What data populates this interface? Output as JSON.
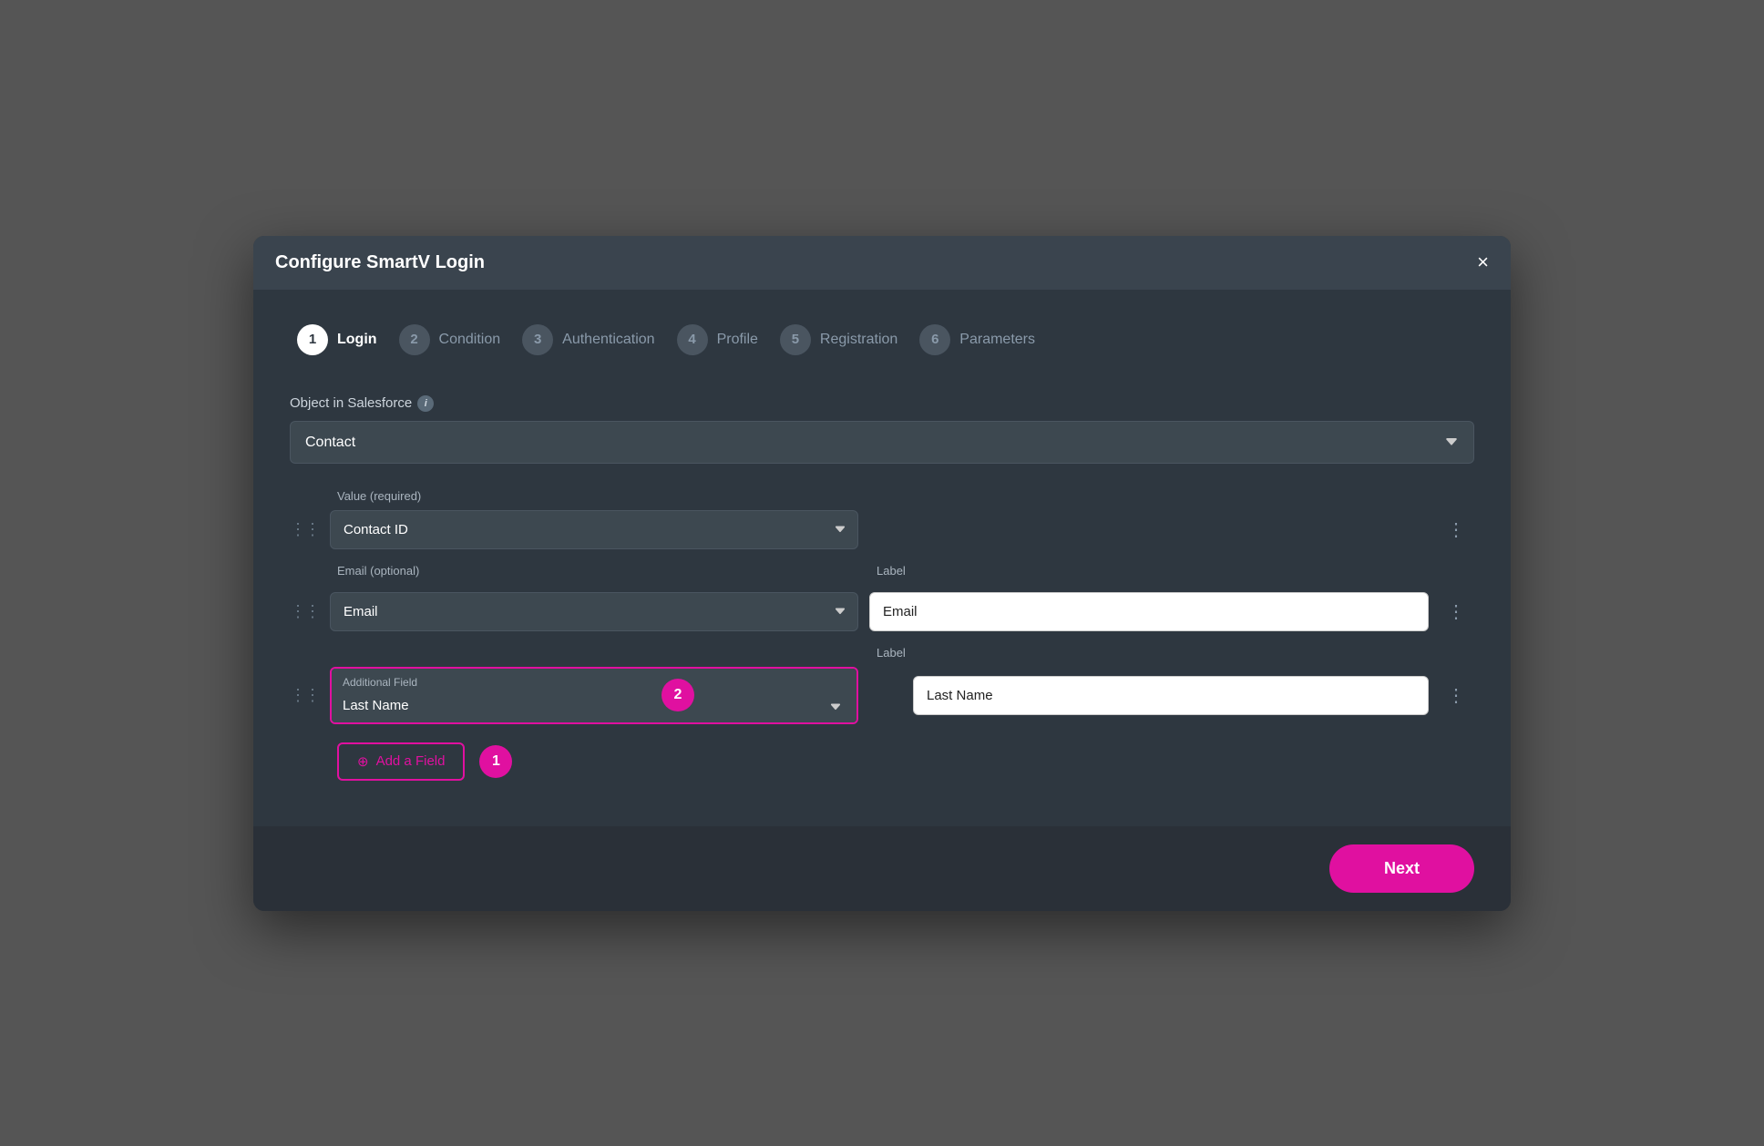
{
  "modal": {
    "title": "Configure SmartV Login",
    "close_label": "×"
  },
  "steps": [
    {
      "number": "1",
      "label": "Login",
      "active": true
    },
    {
      "number": "2",
      "label": "Condition",
      "active": false
    },
    {
      "number": "3",
      "label": "Authentication",
      "active": false
    },
    {
      "number": "4",
      "label": "Profile",
      "active": false
    },
    {
      "number": "5",
      "label": "Registration",
      "active": false
    },
    {
      "number": "6",
      "label": "Parameters",
      "active": false
    }
  ],
  "form": {
    "object_label": "Object in Salesforce",
    "object_value": "Contact",
    "value_required_label": "Value (required)",
    "contact_id_label": "Contact ID",
    "email_optional_label": "Email (optional)",
    "email_field_value": "Email",
    "email_label_label": "Label",
    "email_label_value": "Email",
    "additional_field_label": "Additional Field",
    "last_name_field_value": "Last Name",
    "last_name_label_label": "Label",
    "last_name_label_value": "Last Name",
    "add_field_label": "Add a Field"
  },
  "footer": {
    "next_label": "Next"
  },
  "icons": {
    "info": "i",
    "drag": "⋮⋮",
    "dots": "⋮",
    "plus": "⊕",
    "chevron_down": "▾"
  }
}
